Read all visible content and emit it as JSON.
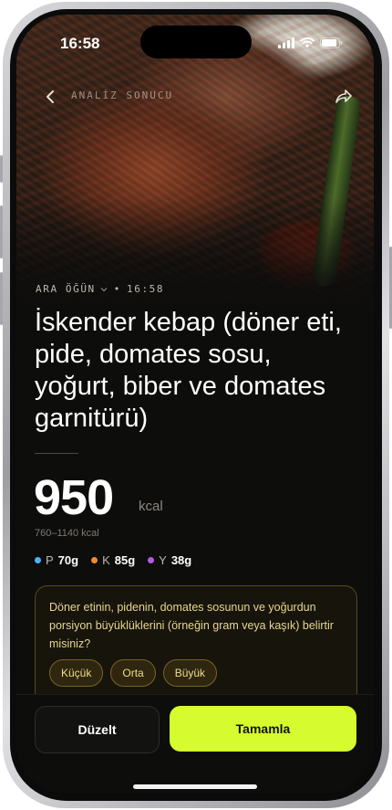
{
  "status_bar": {
    "time": "16:58"
  },
  "header": {
    "title": "ANALİZ SONUCU"
  },
  "meal": {
    "type_label": "ARA ÖĞÜN",
    "separator": "•",
    "time": "16:58",
    "title": "İskender kebap (döner eti, pide, domates sosu, yoğurt, biber ve domates garnitürü)"
  },
  "calories": {
    "value": "950",
    "unit": "kcal",
    "range": "760–1140 kcal"
  },
  "macros": [
    {
      "letter": "P",
      "value": "70g",
      "color": "#4db3f2"
    },
    {
      "letter": "K",
      "value": "85g",
      "color": "#f28b2a"
    },
    {
      "letter": "Y",
      "value": "38g",
      "color": "#b45ae8"
    }
  ],
  "question": {
    "text": "Döner etinin, pidenin, domates sosunun ve yoğurdun porsiyon büyüklüklerini (örneğin gram veya kaşık) belirtir misiniz?",
    "options": [
      "Küçük",
      "Orta",
      "Büyük"
    ]
  },
  "actions": {
    "edit_label": "Düzelt",
    "done_label": "Tamamla"
  },
  "colors": {
    "accent": "#d6fb2e",
    "question_text": "#e7d68d"
  }
}
